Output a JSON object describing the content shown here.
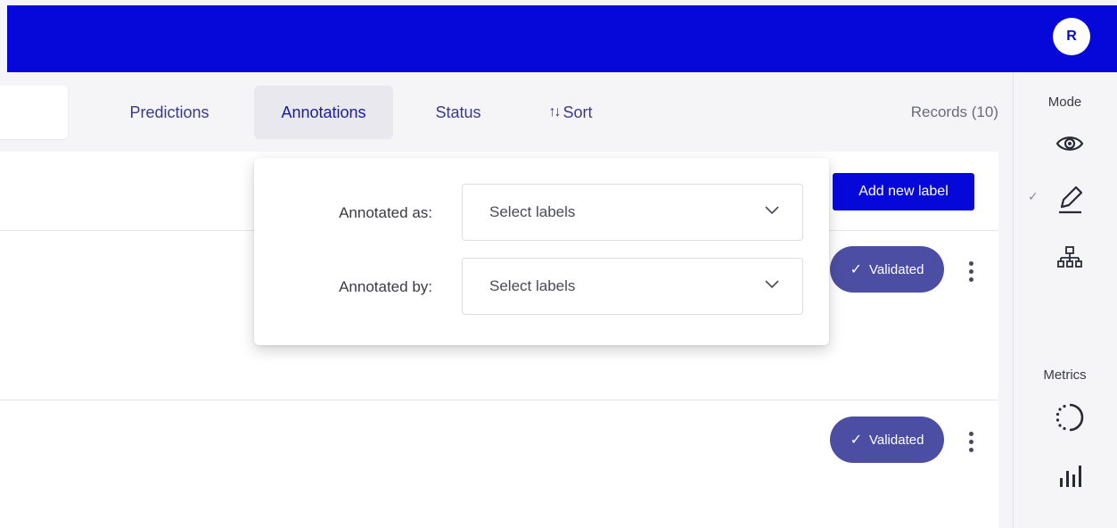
{
  "user": {
    "initial": "R"
  },
  "filters": {
    "tabs": [
      {
        "label": "Predictions"
      },
      {
        "label": "Annotations"
      },
      {
        "label": "Status"
      },
      {
        "label": "Sort",
        "icon": "↑↓"
      }
    ],
    "active_tab": "Annotations",
    "records_label": "Records (10)"
  },
  "toolbar": {
    "add_label": "Add new label"
  },
  "records": [
    {
      "status": "Validated"
    },
    {
      "status": "Validated"
    }
  ],
  "sidebar": {
    "mode_heading": "Mode",
    "metrics_heading": "Metrics",
    "mode_icons": [
      "eye-icon",
      "pencil-icon",
      "hierarchy-icon"
    ],
    "metrics_icons": [
      "progress-circle-icon",
      "bar-chart-icon"
    ],
    "selected_mode": "pencil-icon"
  },
  "dropdown": {
    "rows": [
      {
        "label": "Annotated as:",
        "placeholder": "Select labels"
      },
      {
        "label": "Annotated by:",
        "placeholder": "Select labels"
      }
    ]
  },
  "colors": {
    "brand": "#0508d9",
    "badge": "#4b4ea3",
    "background": "#f5f5f7"
  }
}
